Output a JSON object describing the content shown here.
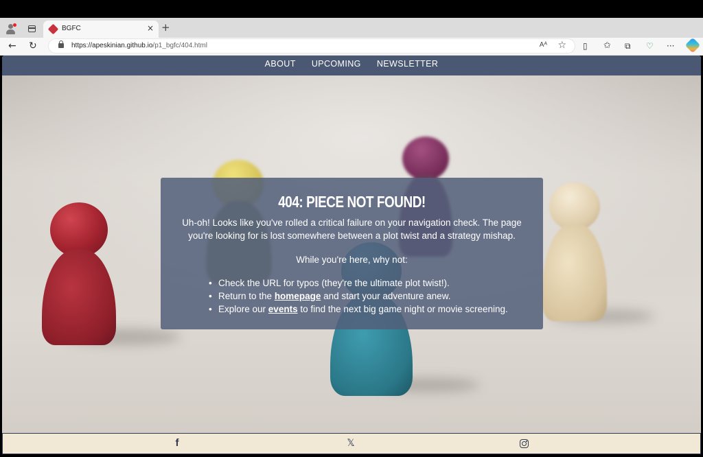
{
  "browser": {
    "tab_title": "BGFC",
    "url_host": "https://apeskinian.github.io",
    "url_path": "/p1_bgfc/404.html",
    "read_aloud_label": "Aᴬ",
    "new_tab_symbol": "+",
    "close_tab_symbol": "×",
    "more_symbol": "···"
  },
  "nav": {
    "items": [
      "ABOUT",
      "UPCOMING",
      "NEWSLETTER"
    ]
  },
  "error": {
    "heading": "404: PIECE NOT FOUND!",
    "intro": "Uh-oh! Looks like you've rolled a critical failure on your navigation check. The page you're looking for is lost somewhere between a plot twist and a strategy mishap.",
    "while_here": "While you're here, why not:",
    "items": [
      {
        "text": "Check the URL for typos (they're the ultimate plot twist!)."
      },
      {
        "before": "Return to the ",
        "link": "homepage",
        "after": " and start your adventure anew."
      },
      {
        "before": "Explore our ",
        "link": "events",
        "after": " to find the next big game night or movie screening."
      }
    ]
  },
  "footer": {
    "icons": [
      "facebook-icon",
      "x-icon",
      "instagram-icon"
    ]
  },
  "colors": {
    "nav_bg": "#4a5874",
    "card_bg": "#53607a",
    "footer_bg": "#f1e8d6",
    "footer_border": "#2f3a52",
    "pawn_red": "#a3232f",
    "pawn_yellow": "#d6c25a",
    "pawn_purple": "#7a2f5c",
    "pawn_beige": "#e0cfae",
    "pawn_teal": "#2f7f8f"
  }
}
